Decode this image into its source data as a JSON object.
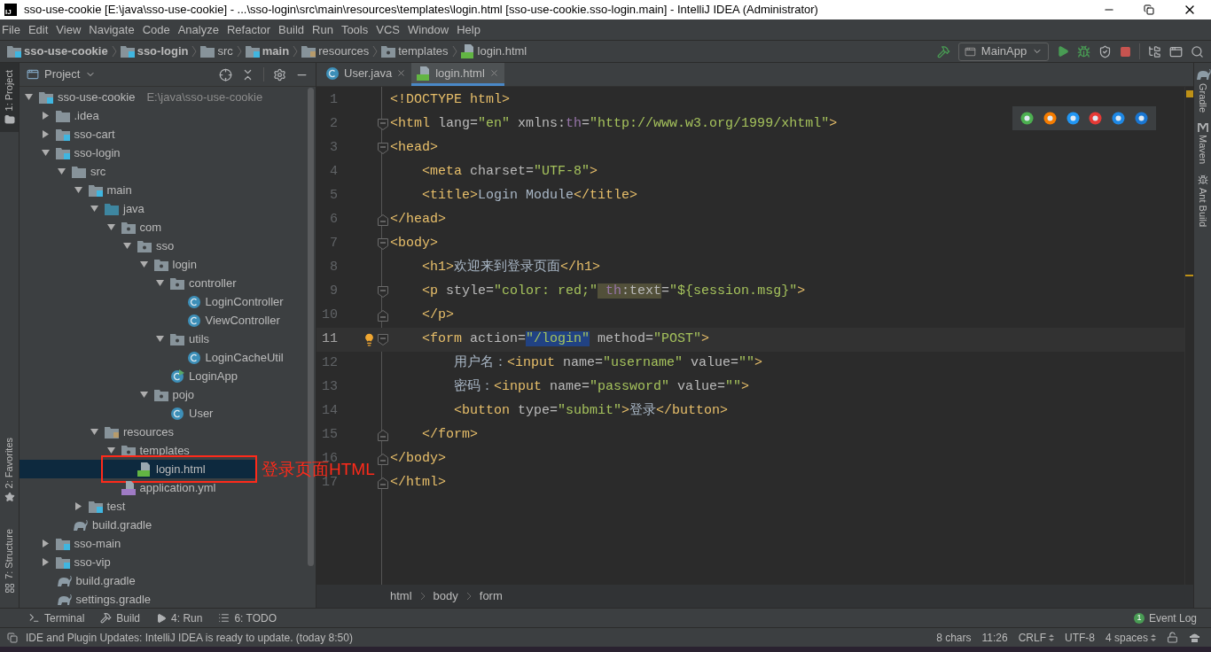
{
  "window": {
    "app_badge": "IJ",
    "title": "sso-use-cookie [E:\\java\\sso-use-cookie] - ...\\sso-login\\src\\main\\resources\\templates\\login.html [sso-use-cookie.sso-login.main] - IntelliJ IDEA (Administrator)"
  },
  "menu": [
    "File",
    "Edit",
    "View",
    "Navigate",
    "Code",
    "Analyze",
    "Refactor",
    "Build",
    "Run",
    "Tools",
    "VCS",
    "Window",
    "Help"
  ],
  "nav_path": [
    {
      "label": "sso-use-cookie",
      "kind": "module",
      "bold": true
    },
    {
      "label": "sso-login",
      "kind": "module",
      "bold": true
    },
    {
      "label": "src",
      "kind": "folder",
      "bold": false
    },
    {
      "label": "main",
      "kind": "module",
      "bold": true
    },
    {
      "label": "resources",
      "kind": "resources",
      "bold": false
    },
    {
      "label": "templates",
      "kind": "package",
      "bold": false
    },
    {
      "label": "login.html",
      "kind": "html",
      "bold": false
    }
  ],
  "run_config": "MainApp",
  "left_stripe": [
    {
      "label": "1: Project",
      "selected": true,
      "kind": "folder"
    },
    {
      "label": "2: Favorites",
      "selected": false,
      "kind": "star"
    },
    {
      "label": "7: Structure",
      "selected": false,
      "kind": "structure"
    }
  ],
  "right_stripe": [
    {
      "label": "Gradle",
      "kind": "gradle"
    },
    {
      "label": "Maven",
      "kind": "maven"
    },
    {
      "label": "Ant Build",
      "kind": "ant"
    }
  ],
  "project_panel": {
    "title": "Project",
    "tree": [
      {
        "label": "sso-use-cookie",
        "hint": "E:\\java\\sso-use-cookie",
        "kind": "module",
        "expanded": true,
        "selected": false,
        "children": [
          {
            "label": ".idea",
            "kind": "folder",
            "expanded": false,
            "selected": false
          },
          {
            "label": "sso-cart",
            "kind": "module",
            "expanded": false,
            "selected": false
          },
          {
            "label": "sso-login",
            "kind": "module",
            "expanded": true,
            "selected": false,
            "children": [
              {
                "label": "src",
                "kind": "folder",
                "expanded": true,
                "selected": false,
                "children": [
                  {
                    "label": "main",
                    "kind": "module",
                    "expanded": true,
                    "selected": false,
                    "children": [
                      {
                        "label": "java",
                        "kind": "source",
                        "expanded": true,
                        "selected": false,
                        "children": [
                          {
                            "label": "com",
                            "kind": "package",
                            "expanded": true,
                            "selected": false,
                            "children": [
                              {
                                "label": "sso",
                                "kind": "package",
                                "expanded": true,
                                "selected": false,
                                "children": [
                                  {
                                    "label": "login",
                                    "kind": "package",
                                    "expanded": true,
                                    "selected": false,
                                    "children": [
                                      {
                                        "label": "controller",
                                        "kind": "package",
                                        "expanded": true,
                                        "selected": false,
                                        "children": [
                                          {
                                            "label": "LoginController",
                                            "kind": "class",
                                            "selected": false
                                          },
                                          {
                                            "label": "ViewController",
                                            "kind": "class",
                                            "selected": false
                                          }
                                        ]
                                      },
                                      {
                                        "label": "utils",
                                        "kind": "package",
                                        "expanded": true,
                                        "selected": false,
                                        "children": [
                                          {
                                            "label": "LoginCacheUtil",
                                            "kind": "class",
                                            "selected": false
                                          }
                                        ]
                                      },
                                      {
                                        "label": "LoginApp",
                                        "kind": "main-class",
                                        "selected": false
                                      }
                                    ]
                                  },
                                  {
                                    "label": "pojo",
                                    "kind": "package",
                                    "expanded": true,
                                    "selected": false,
                                    "children": [
                                      {
                                        "label": "User",
                                        "kind": "class",
                                        "selected": false
                                      }
                                    ]
                                  }
                                ]
                              }
                            ]
                          }
                        ]
                      },
                      {
                        "label": "resources",
                        "kind": "resources",
                        "expanded": true,
                        "selected": false,
                        "children": [
                          {
                            "label": "templates",
                            "kind": "package",
                            "expanded": true,
                            "selected": false,
                            "children": [
                              {
                                "label": "login.html",
                                "kind": "html",
                                "selected": true,
                                "annotation": "登录页面HTML"
                              }
                            ]
                          },
                          {
                            "label": "application.yml",
                            "kind": "yml",
                            "selected": false
                          }
                        ]
                      }
                    ]
                  },
                  {
                    "label": "test",
                    "kind": "module",
                    "expanded": false,
                    "selected": false
                  }
                ]
              },
              {
                "label": "build.gradle",
                "kind": "gradle",
                "selected": false
              }
            ]
          },
          {
            "label": "sso-main",
            "kind": "module",
            "expanded": false,
            "selected": false
          },
          {
            "label": "sso-vip",
            "kind": "module",
            "expanded": false,
            "selected": false
          },
          {
            "label": "build.gradle",
            "kind": "gradle",
            "selected": false
          },
          {
            "label": "settings.gradle",
            "kind": "gradle",
            "selected": false
          }
        ]
      }
    ]
  },
  "editor_tabs": [
    {
      "label": "User.java",
      "kind": "class",
      "selected": false
    },
    {
      "label": "login.html",
      "kind": "html",
      "selected": true
    }
  ],
  "code_lines": [
    {
      "number": "1",
      "current": false,
      "fold_start": false,
      "fold_end": false,
      "tokens": [
        {
          "text": "<!DOCTYPE html>",
          "kind": "tag"
        }
      ]
    },
    {
      "number": "2",
      "current": false,
      "fold_start": true,
      "fold_end": false,
      "tokens": [
        {
          "text": "<html ",
          "kind": "tag"
        },
        {
          "text": "lang=",
          "kind": "attr"
        },
        {
          "text": "\"en\"",
          "kind": "str"
        },
        {
          "text": " xmlns:",
          "kind": "attr"
        },
        {
          "text": "th",
          "kind": "ns"
        },
        {
          "text": "=",
          "kind": "attr"
        },
        {
          "text": "\"http://www.w3.org/1999/xhtml\"",
          "kind": "str"
        },
        {
          "text": ">",
          "kind": "tag"
        }
      ]
    },
    {
      "number": "3",
      "current": false,
      "fold_start": true,
      "fold_end": false,
      "tokens": [
        {
          "text": "<head>",
          "kind": "tag"
        }
      ]
    },
    {
      "number": "4",
      "current": false,
      "fold_start": false,
      "fold_end": false,
      "tokens": [
        {
          "text": "    <meta ",
          "kind": "tag"
        },
        {
          "text": "charset=",
          "kind": "attr"
        },
        {
          "text": "\"UTF-8\"",
          "kind": "str"
        },
        {
          "text": ">",
          "kind": "tag"
        }
      ]
    },
    {
      "number": "5",
      "current": false,
      "fold_start": false,
      "fold_end": false,
      "tokens": [
        {
          "text": "    <title>",
          "kind": "tag"
        },
        {
          "text": "Login Module",
          "kind": "text"
        },
        {
          "text": "</title>",
          "kind": "tag"
        }
      ]
    },
    {
      "number": "6",
      "current": false,
      "fold_start": false,
      "fold_end": true,
      "tokens": [
        {
          "text": "</head>",
          "kind": "tag"
        }
      ]
    },
    {
      "number": "7",
      "current": false,
      "fold_start": true,
      "fold_end": false,
      "tokens": [
        {
          "text": "<body>",
          "kind": "tag"
        }
      ]
    },
    {
      "number": "8",
      "current": false,
      "fold_start": false,
      "fold_end": false,
      "tokens": [
        {
          "text": "    <h1>",
          "kind": "tag"
        },
        {
          "text": "欢迎来到登录页面",
          "kind": "text"
        },
        {
          "text": "</h1>",
          "kind": "tag"
        }
      ]
    },
    {
      "number": "9",
      "current": false,
      "fold_start": true,
      "fold_end": false,
      "tokens": [
        {
          "text": "    <p ",
          "kind": "tag"
        },
        {
          "text": "style=",
          "kind": "attr"
        },
        {
          "text": "\"color: red;\"",
          "kind": "str"
        },
        {
          "text": " th",
          "kind": "ns",
          "usage_highlight": true
        },
        {
          "text": ":text",
          "kind": "attr",
          "usage_highlight": true
        },
        {
          "text": "=",
          "kind": "attr"
        },
        {
          "text": "\"${session.msg}\"",
          "kind": "str"
        },
        {
          "text": ">",
          "kind": "tag"
        }
      ]
    },
    {
      "number": "10",
      "current": false,
      "fold_start": false,
      "fold_end": true,
      "tokens": [
        {
          "text": "    </p>",
          "kind": "tag"
        }
      ]
    },
    {
      "number": "11",
      "current": true,
      "fold_start": true,
      "fold_end": false,
      "bulb": true,
      "tokens": [
        {
          "text": "    <form ",
          "kind": "tag"
        },
        {
          "text": "action=",
          "kind": "attr"
        },
        {
          "text": "\"/login\"",
          "kind": "str",
          "selected": true
        },
        {
          "text": " method=",
          "kind": "attr"
        },
        {
          "text": "\"POST\"",
          "kind": "str"
        },
        {
          "text": ">",
          "kind": "tag"
        }
      ]
    },
    {
      "number": "12",
      "current": false,
      "fold_start": false,
      "fold_end": false,
      "tokens": [
        {
          "text": "        用户名：",
          "kind": "text"
        },
        {
          "text": "<input ",
          "kind": "tag"
        },
        {
          "text": "name=",
          "kind": "attr"
        },
        {
          "text": "\"username\"",
          "kind": "str"
        },
        {
          "text": " value=",
          "kind": "attr"
        },
        {
          "text": "\"\"",
          "kind": "str"
        },
        {
          "text": ">",
          "kind": "tag"
        }
      ]
    },
    {
      "number": "13",
      "current": false,
      "fold_start": false,
      "fold_end": false,
      "tokens": [
        {
          "text": "        密码：",
          "kind": "text"
        },
        {
          "text": "<input ",
          "kind": "tag"
        },
        {
          "text": "name=",
          "kind": "attr"
        },
        {
          "text": "\"password\"",
          "kind": "str"
        },
        {
          "text": " value=",
          "kind": "attr"
        },
        {
          "text": "\"\"",
          "kind": "str"
        },
        {
          "text": ">",
          "kind": "tag"
        }
      ]
    },
    {
      "number": "14",
      "current": false,
      "fold_start": false,
      "fold_end": false,
      "tokens": [
        {
          "text": "        <button ",
          "kind": "tag"
        },
        {
          "text": "type=",
          "kind": "attr"
        },
        {
          "text": "\"submit\"",
          "kind": "str"
        },
        {
          "text": ">",
          "kind": "tag"
        },
        {
          "text": "登录",
          "kind": "text"
        },
        {
          "text": "</button>",
          "kind": "tag"
        }
      ]
    },
    {
      "number": "15",
      "current": false,
      "fold_start": false,
      "fold_end": true,
      "tokens": [
        {
          "text": "    </form>",
          "kind": "tag"
        }
      ]
    },
    {
      "number": "16",
      "current": false,
      "fold_start": false,
      "fold_end": true,
      "tokens": [
        {
          "text": "</body>",
          "kind": "tag"
        }
      ]
    },
    {
      "number": "17",
      "current": false,
      "fold_start": false,
      "fold_end": true,
      "tokens": [
        {
          "text": "</html>",
          "kind": "tag"
        }
      ]
    }
  ],
  "browsers": [
    {
      "color": "#4caf50"
    },
    {
      "color": "#f57c00"
    },
    {
      "color": "#2196f3"
    },
    {
      "color": "#e53935"
    },
    {
      "color": "#1e88e5"
    },
    {
      "color": "#1976d2"
    }
  ],
  "editor_breadcrumbs": [
    "html",
    "body",
    "form"
  ],
  "tool_tabs": [
    {
      "label": "Terminal",
      "kind": "terminal"
    },
    {
      "label": "Build",
      "kind": "build"
    },
    {
      "label": "4: Run",
      "kind": "run"
    },
    {
      "label": "6: TODO",
      "kind": "todo"
    }
  ],
  "event_log": {
    "count": "1",
    "label": "Event Log"
  },
  "status_bar": {
    "message": "IDE and Plugin Updates: IntelliJ IDEA is ready to update. (today 8:50)",
    "items": [
      {
        "label": "8 chars",
        "dropdown": false
      },
      {
        "label": "11:26",
        "dropdown": false
      },
      {
        "label": "CRLF",
        "dropdown": true
      },
      {
        "label": "UTF-8",
        "dropdown": false
      },
      {
        "label": "4 spaces",
        "dropdown": true
      }
    ]
  }
}
